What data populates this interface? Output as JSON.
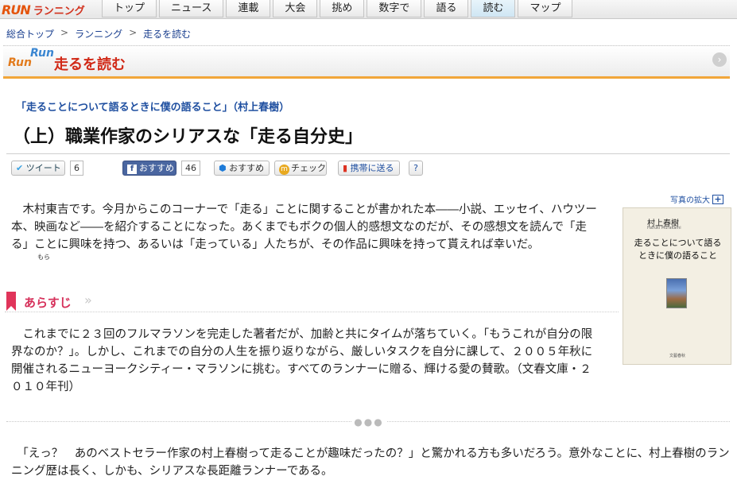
{
  "brand": {
    "logo_text": "RUN",
    "site_name": "ランニング"
  },
  "nav": {
    "tabs": [
      "トップ",
      "ニュース",
      "連載",
      "大会",
      "挑め",
      "数字で",
      "語る",
      "読む",
      "マップ"
    ],
    "active_index": 7
  },
  "breadcrumb": {
    "items": [
      "総合トップ",
      "ランニング",
      "走るを読む"
    ],
    "separator": ">"
  },
  "section": {
    "logo_line1": "Run",
    "logo_line2": "Run",
    "title": "走るを読む",
    "arrow": "›"
  },
  "article": {
    "series_title": "「走ることについて語るときに僕の語ること」（村上春樹）",
    "title": "（上）職業作家のシリアスな「走る自分史」"
  },
  "share": {
    "tweet_label": "ツイート",
    "tweet_count": "6",
    "fb_label": "おすすめ",
    "fb_count": "46",
    "g_label": "おすすめ",
    "mixi_label": "チェック",
    "keitai_label": "携帯に送る",
    "help_label": "?"
  },
  "intro": {
    "text": "　木村東吉です。今月からこのコーナーで「走る」ことに関することが書かれた本――小説、エッセイ、ハウツー本、映画など――を紹介することになった。あくまでもボクの個人的感想文なのだが、その感想文を読んで「走る」ことに興味を持つ、あるいは「走っている」人たちが、その作品に興味を持って貰えれば幸いだ。",
    "ruby": "もら"
  },
  "synopsis": {
    "heading": "あらすじ",
    "text": "　これまでに２３回のフルマラソンを完走した著者だが、加齢と共にタイムが落ちていく。「もうこれが自分の限界なのか？」。しかし、これまでの自分の人生を振り返りながら、厳しいタスクを自分に課して、２００５年秋に開催されるニューヨークシティー・マラソンに挑む。すべてのランナーに贈る、輝ける愛の賛歌。（文春文庫・２０１０年刊）"
  },
  "closing": {
    "text": "　「えっ？　あのベストセラー作家の村上春樹って走ることが趣味だったの？」と驚かれる方も多いだろう。意外なことに、村上春樹のランニング歴は長く、しかも、シリアスな長距離ランナーである。"
  },
  "photo": {
    "enlarge_label": "写真の拡大",
    "author": "村上春樹",
    "author_romaji": "Haruki Murakami",
    "book_title": "走ることについて語るときに僕の語ること",
    "publisher": "文藝春秋"
  },
  "colors": {
    "accent_red": "#d12a18",
    "link_blue": "#1f4fa0",
    "header_orange": "#f1a63a",
    "synopsis_pink": "#d6305a"
  }
}
